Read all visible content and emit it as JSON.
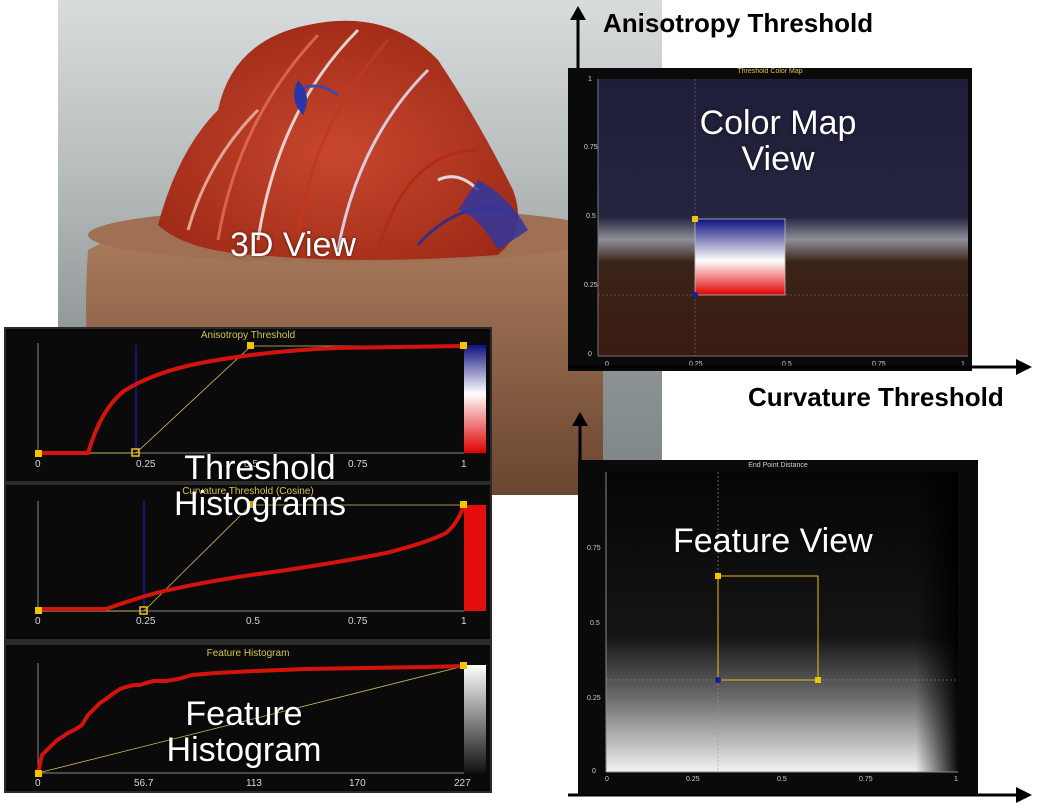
{
  "labels": {
    "view3d": "3D View",
    "threshold_histograms": [
      "Threshold",
      "Histograms"
    ],
    "feature_histogram": [
      "Feature",
      "Histogram"
    ],
    "color_map_view": [
      "Color Map",
      "View"
    ],
    "feature_view": "Feature View"
  },
  "axes": {
    "anisotropy_threshold": "Anisotropy Threshold",
    "curvature_threshold": "Curvature Threshold"
  },
  "panels": {
    "anisotropy": {
      "title": "Anisotropy Threshold",
      "ticks": [
        "0",
        "0.25",
        "0.5",
        "0.75",
        "1"
      ]
    },
    "curvature": {
      "title": "Curvature Threshold (Cosine)",
      "ticks": [
        "0",
        "0.25",
        "0.5",
        "0.75",
        "1"
      ]
    },
    "feature": {
      "title": "Feature Histogram",
      "ticks": [
        "0",
        "56.7",
        "113",
        "170",
        "227"
      ]
    },
    "colormap": {
      "title": "Threshold Color Map",
      "xticks": [
        "0",
        "0.25",
        "0.5",
        "0.75",
        "1"
      ],
      "yticks": [
        "1",
        "0.75",
        "0.5",
        "0.25",
        "0"
      ]
    },
    "endpoint": {
      "title": "End Point Distance",
      "xticks": [
        "0",
        "0.25",
        "0.5",
        "0.75",
        "1"
      ],
      "yticks": [
        "0.75",
        "0.5",
        "0.25",
        "0"
      ]
    }
  },
  "colors": {
    "curve_red": "#d4140c",
    "handle_yellow": "#f5c400",
    "threshold_blue": "#1a1aa0",
    "colormap_bg": "#1f1f3a",
    "colormap_brown": "#3a1a10"
  }
}
